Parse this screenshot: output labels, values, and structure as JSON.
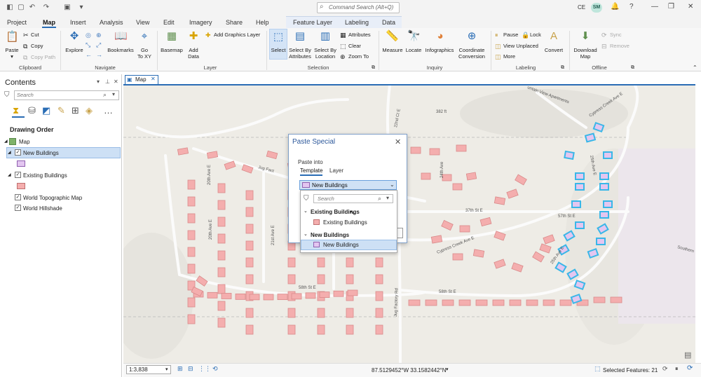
{
  "titlebar": {
    "search_placeholder": "Command Search (Alt+Q)",
    "user_initials_left": "CE",
    "avatar_initials": "SM"
  },
  "tabs": [
    "Project",
    "Map",
    "Insert",
    "Analysis",
    "View",
    "Edit",
    "Imagery",
    "Share",
    "Help",
    "Feature Layer",
    "Labeling",
    "Data"
  ],
  "ribbon": {
    "clipboard": {
      "paste": "Paste",
      "cut": "Cut",
      "copy": "Copy",
      "copy_path": "Copy Path",
      "group": "Clipboard"
    },
    "navigate": {
      "explore": "Explore",
      "bookmarks": "Bookmarks",
      "go_to_xy_1": "Go",
      "go_to_xy_2": "To XY",
      "group": "Navigate"
    },
    "layer": {
      "basemap": "Basemap",
      "add_data_1": "Add",
      "add_data_2": "Data",
      "add_graphics": "Add Graphics Layer",
      "group": "Layer"
    },
    "selection": {
      "select": "Select",
      "by_attr_1": "Select By",
      "by_attr_2": "Attributes",
      "by_loc_1": "Select By",
      "by_loc_2": "Location",
      "attributes": "Attributes",
      "clear": "Clear",
      "zoom_to": "Zoom To",
      "group": "Selection"
    },
    "inquiry": {
      "measure": "Measure",
      "locate": "Locate",
      "infographics": "Infographics",
      "coord_1": "Coordinate",
      "coord_2": "Conversion",
      "group": "Inquiry"
    },
    "labeling": {
      "pause": "Pause",
      "lock": "Lock",
      "view_unplaced": "View Unplaced",
      "more": "More",
      "convert": "Convert",
      "group": "Labeling"
    },
    "offline": {
      "download_1": "Download",
      "download_2": "Map",
      "sync": "Sync",
      "remove": "Remove",
      "group": "Offline"
    }
  },
  "contents": {
    "title": "Contents",
    "search_placeholder": "Search",
    "drawing_order": "Drawing Order",
    "layers": [
      {
        "name": "Map"
      },
      {
        "name": "New Buildings",
        "checked": true
      },
      {
        "name": "Existing Buildings",
        "checked": true
      },
      {
        "name": "World Topographic Map",
        "checked": true
      },
      {
        "name": "World Hillshade",
        "checked": true
      }
    ]
  },
  "map": {
    "tab_label": "Map",
    "spot_height": "382 ft",
    "streets": [
      "Jug Factory Rd",
      "20th Ave E",
      "21st Ave E",
      "22nd Ct E",
      "24th Ave",
      "25th Ave E",
      "37th St E",
      "57th St E",
      "58th St E",
      "58th St E",
      "Cypress Creek Ave E",
      "Cypress Creek Ave E",
      "Southern",
      "untain View Apartments",
      "Jug Fact"
    ]
  },
  "colors": {
    "existing_fill": "#f4aeae",
    "existing_stroke": "#d98a8a",
    "new_fill": "#e3c6f0",
    "new_stroke": "#39b7e8",
    "accent": "#2a6db5"
  },
  "dialog": {
    "title": "Paste Special",
    "paste_into": "Paste into",
    "tab_template": "Template",
    "tab_layer": "Layer",
    "selected": "New Buildings",
    "search_placeholder": "Search",
    "groups": [
      {
        "header": "Existing Buildings",
        "item": "Existing Buildings"
      },
      {
        "header": "New Buildings",
        "item": "New Buildings"
      }
    ]
  },
  "status": {
    "scale": "1:3,838",
    "coordinates": "87.5129452°W 33.1582442°N",
    "selected_features": "Selected Features: 21"
  }
}
